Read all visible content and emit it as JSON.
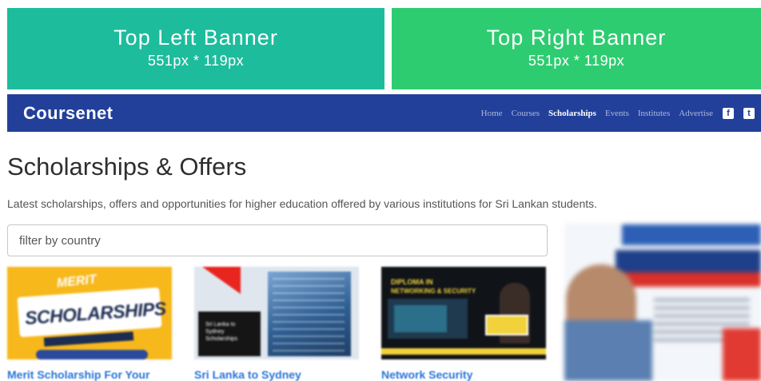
{
  "banners": {
    "left": {
      "title": "Top Left Banner",
      "size": "551px * 119px",
      "color": "#1dbc9c"
    },
    "right": {
      "title": "Top Right Banner",
      "size": "551px * 119px",
      "color": "#2ecc71"
    }
  },
  "navbar": {
    "brand": "Coursenet",
    "color": "#22409a",
    "links": [
      {
        "label": "Home",
        "active": false
      },
      {
        "label": "Courses",
        "active": false
      },
      {
        "label": "Scholarships",
        "active": true
      },
      {
        "label": "Events",
        "active": false
      },
      {
        "label": "Institutes",
        "active": false
      },
      {
        "label": "Advertise",
        "active": false
      }
    ],
    "social": [
      {
        "icon": "facebook-icon",
        "glyph": "f"
      },
      {
        "icon": "twitter-icon",
        "glyph": "t"
      }
    ]
  },
  "main": {
    "title": "Scholarships & Offers",
    "description": "Latest scholarships, offers and opportunities for higher education offered by various institutions for Sri Lankan students.",
    "filter": {
      "placeholder": "filter by country",
      "value": ""
    },
    "cards": [
      {
        "title": "Merit Scholarship For Your",
        "thumb_text": {
          "top": "MERIT",
          "main": "SCHOLARSHIPS"
        }
      },
      {
        "title": "Sri Lanka to Sydney",
        "thumb_text": {
          "main": "Sri Lanka to Sydney Scholarships"
        }
      },
      {
        "title": "Network Security",
        "thumb_text": {
          "top": "DIPLOMA IN",
          "main": "NETWORKING & SECURITY"
        }
      }
    ]
  },
  "accent_link_color": "#2a75d8"
}
